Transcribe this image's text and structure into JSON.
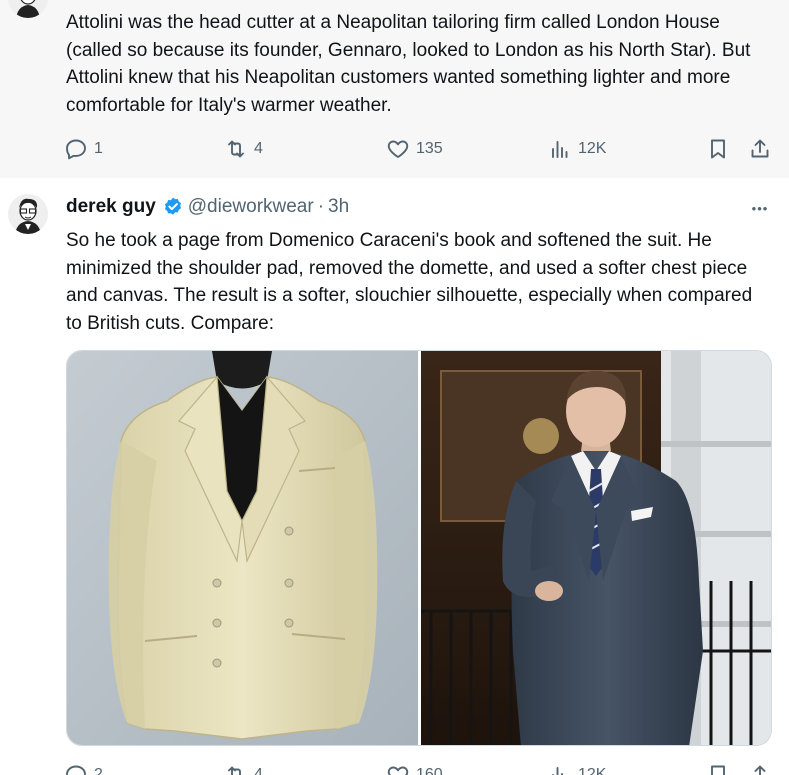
{
  "tweet1": {
    "text": "Attolini was the head cutter at a Neapolitan tailoring firm called London House (called so because its founder, Gennaro, looked to London as his North Star). But Attolini knew that his Neapolitan customers wanted something lighter and more comfortable for Italy's warmer weather.",
    "actions": {
      "replies": "1",
      "reposts": "4",
      "likes": "135",
      "views": "12K"
    }
  },
  "tweet2": {
    "display_name": "derek guy",
    "handle": "@dieworkwear",
    "separator": "·",
    "time": "3h",
    "more_label": "•••",
    "text": "So he took a page from Domenico Caraceni's book and softened the suit. He minimized the shoulder pad, removed the domette, and used a softer chest piece and canvas. The result is a softer, slouchier silhouette, especially when compared to British cuts. Compare:",
    "actions": {
      "replies": "2",
      "reposts": "4",
      "likes": "160",
      "views": "12K"
    }
  },
  "icons": {
    "reply": "reply-icon",
    "repost": "repost-icon",
    "like": "heart-icon",
    "views": "views-icon",
    "bookmark": "bookmark-icon",
    "share": "share-icon",
    "verified": "verified-badge-icon",
    "more": "more-icon"
  },
  "colors": {
    "muted": "#536471",
    "text": "#0f1419",
    "verified": "#1d9bf0",
    "thread_bg": "#f7f7f7"
  }
}
